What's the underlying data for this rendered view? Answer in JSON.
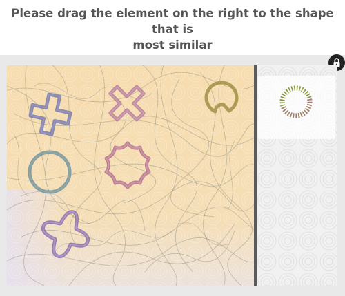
{
  "instruction": {
    "line1": "Please drag the element on the right to the shape that is",
    "line2": "most similar"
  },
  "icons": {
    "lock": "lock-icon"
  },
  "colors": {
    "canvas_bg": "#f7ddb0",
    "shape_blue": "#6e8fa8",
    "shape_rose": "#b06f8a",
    "shape_olive": "#9b9a3a",
    "shape_purple": "#8a6aa8"
  },
  "shapes": [
    {
      "name": "cross-shape",
      "color": "#7b86b0"
    },
    {
      "name": "x-cross-shape",
      "color": "#b07a9a"
    },
    {
      "name": "open-ring-shape",
      "color": "#9b9a3a"
    },
    {
      "name": "circle-shape",
      "color": "#6e8fa8"
    },
    {
      "name": "wavy-star-shape",
      "color": "#b06f8a"
    },
    {
      "name": "four-petal-shape",
      "color": "#8a6aa8"
    }
  ],
  "piece": {
    "name": "dashed-ring-piece"
  }
}
